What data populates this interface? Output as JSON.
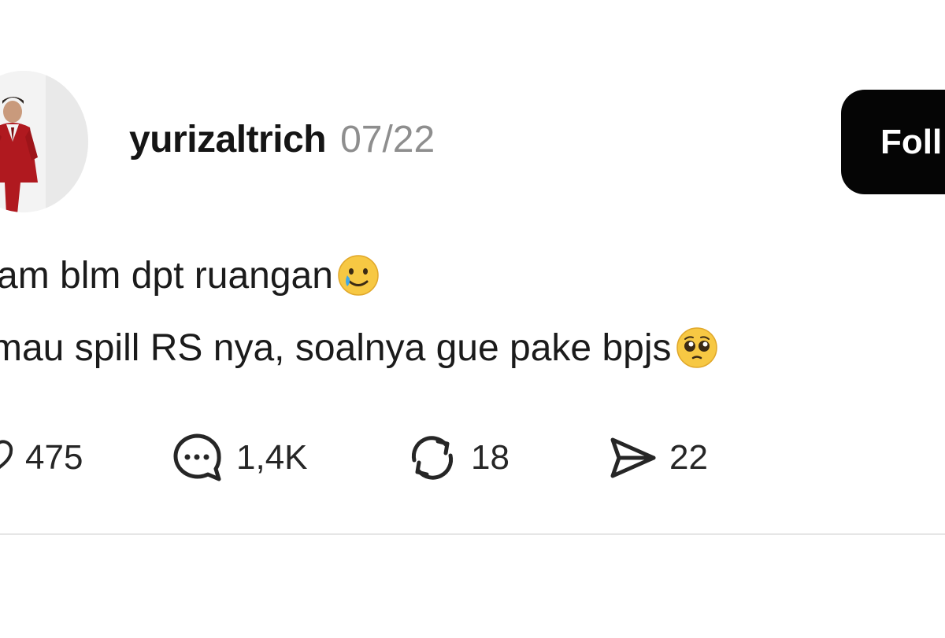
{
  "post": {
    "username": "yurizaltrich",
    "date": "07/22",
    "follow_label": "Foll",
    "text_lines": [
      "am blm dpt ruangan",
      "mau spill RS nya, soalnya gue pake bpjs"
    ],
    "emojis": [
      "smiling-face-with-tear",
      "pleading-face"
    ]
  },
  "actions": {
    "likes": "475",
    "replies": "1,4K",
    "reposts": "18",
    "shares": "22"
  },
  "icons": {
    "like": "heart-icon",
    "reply": "speech-bubble-icon",
    "repost": "repost-icon",
    "share": "paper-plane-icon"
  },
  "colors": {
    "background": "#ffffff",
    "text": "#1a1a1a",
    "muted": "#8e8e8e",
    "button_bg": "#050505",
    "button_text": "#ffffff",
    "divider": "#e6e6e6"
  }
}
